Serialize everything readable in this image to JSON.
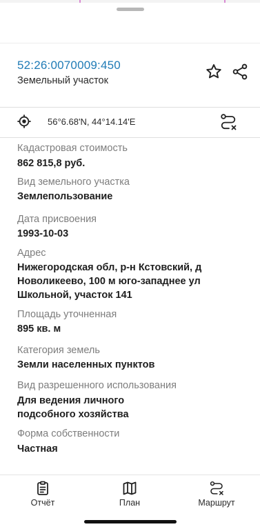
{
  "parcel": {
    "cadastral_number": "52:26:0070009:450",
    "object_type": "Земельный участок"
  },
  "actions": {
    "favorite_icon": "star-icon",
    "share_icon": "share-icon"
  },
  "location": {
    "coordinates": "56°6.68'N, 44°14.14'E",
    "locate_icon": "target-icon",
    "route_clear_icon": "route-clear-icon"
  },
  "details": {
    "cadastral_value": {
      "label": "Кадастровая стоимость",
      "value": "862 815,8 руб."
    },
    "land_kind": {
      "label": "Вид земельного участка",
      "value": "Землепользование"
    },
    "assign_date": {
      "label": "Дата присвоения",
      "value": "1993-10-03"
    },
    "address": {
      "label": "Адрес",
      "value_lines": [
        "Нижегородская обл, р-н Кстовский, д",
        "Новоликеево, 100 м юго-западнее ул",
        "Школьной, участок 141"
      ]
    },
    "area": {
      "label": "Площадь уточненная",
      "value": "895 кв. м"
    },
    "category": {
      "label": "Категория земель",
      "value": "Земли населенных пунктов"
    },
    "permitted_use": {
      "label": "Вид разрешенного использования",
      "value_lines": [
        "Для ведения личного",
        "подсобного хозяйства"
      ]
    },
    "ownership": {
      "label": "Форма собственности",
      "value": "Частная"
    }
  },
  "bottom_nav": {
    "report": {
      "label": "Отчёт",
      "icon": "clipboard-icon"
    },
    "plan": {
      "label": "План",
      "icon": "map-icon"
    },
    "route": {
      "label": "Маршрут",
      "icon": "route-icon"
    }
  },
  "colors": {
    "accent_link": "#1f7bb6",
    "label_gray": "#7d7d7d",
    "map_line": "#d98ad3"
  }
}
